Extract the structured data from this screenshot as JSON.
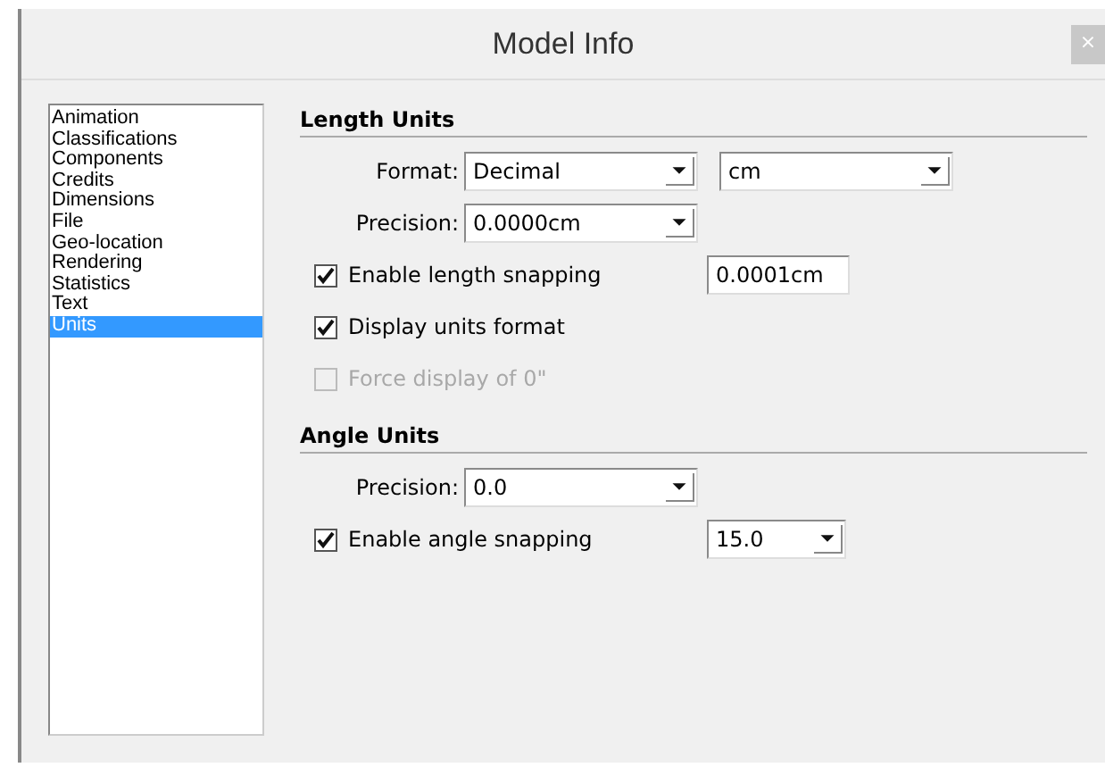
{
  "window": {
    "title": "Model Info",
    "close": "×"
  },
  "sidebar": {
    "items": [
      {
        "label": "Animation",
        "selected": false
      },
      {
        "label": "Classifications",
        "selected": false
      },
      {
        "label": "Components",
        "selected": false
      },
      {
        "label": "Credits",
        "selected": false
      },
      {
        "label": "Dimensions",
        "selected": false
      },
      {
        "label": "File",
        "selected": false
      },
      {
        "label": "Geo-location",
        "selected": false
      },
      {
        "label": "Rendering",
        "selected": false
      },
      {
        "label": "Statistics",
        "selected": false
      },
      {
        "label": "Text",
        "selected": false
      },
      {
        "label": "Units",
        "selected": true
      }
    ]
  },
  "sections": [
    {
      "title": "Length Units",
      "rows": [
        {
          "kind": "select",
          "label": "Format:",
          "fields": [
            {
              "kind": "dropdown",
              "value": "Decimal"
            },
            {
              "kind": "dropdown",
              "value": "cm"
            }
          ]
        },
        {
          "kind": "select",
          "label": "Precision:",
          "fields": [
            {
              "kind": "dropdown",
              "value": "0.0000cm"
            }
          ]
        },
        {
          "kind": "checkbox",
          "label": "Enable length snapping",
          "checked": true,
          "disabled": false,
          "fields": [
            {
              "kind": "text",
              "value": "0.0001cm"
            }
          ]
        },
        {
          "kind": "checkbox",
          "label": "Display units format",
          "checked": true,
          "disabled": false
        },
        {
          "kind": "checkbox",
          "label": "Force display of 0\"",
          "checked": false,
          "disabled": true
        }
      ]
    },
    {
      "title": "Angle Units",
      "rows": [
        {
          "kind": "select",
          "label": "Precision:",
          "fields": [
            {
              "kind": "dropdown",
              "value": "0.0"
            }
          ]
        },
        {
          "kind": "checkbox",
          "label": "Enable angle snapping",
          "checked": true,
          "disabled": false,
          "fields": [
            {
              "kind": "small-dropdown",
              "value": "15.0"
            }
          ]
        }
      ]
    }
  ]
}
